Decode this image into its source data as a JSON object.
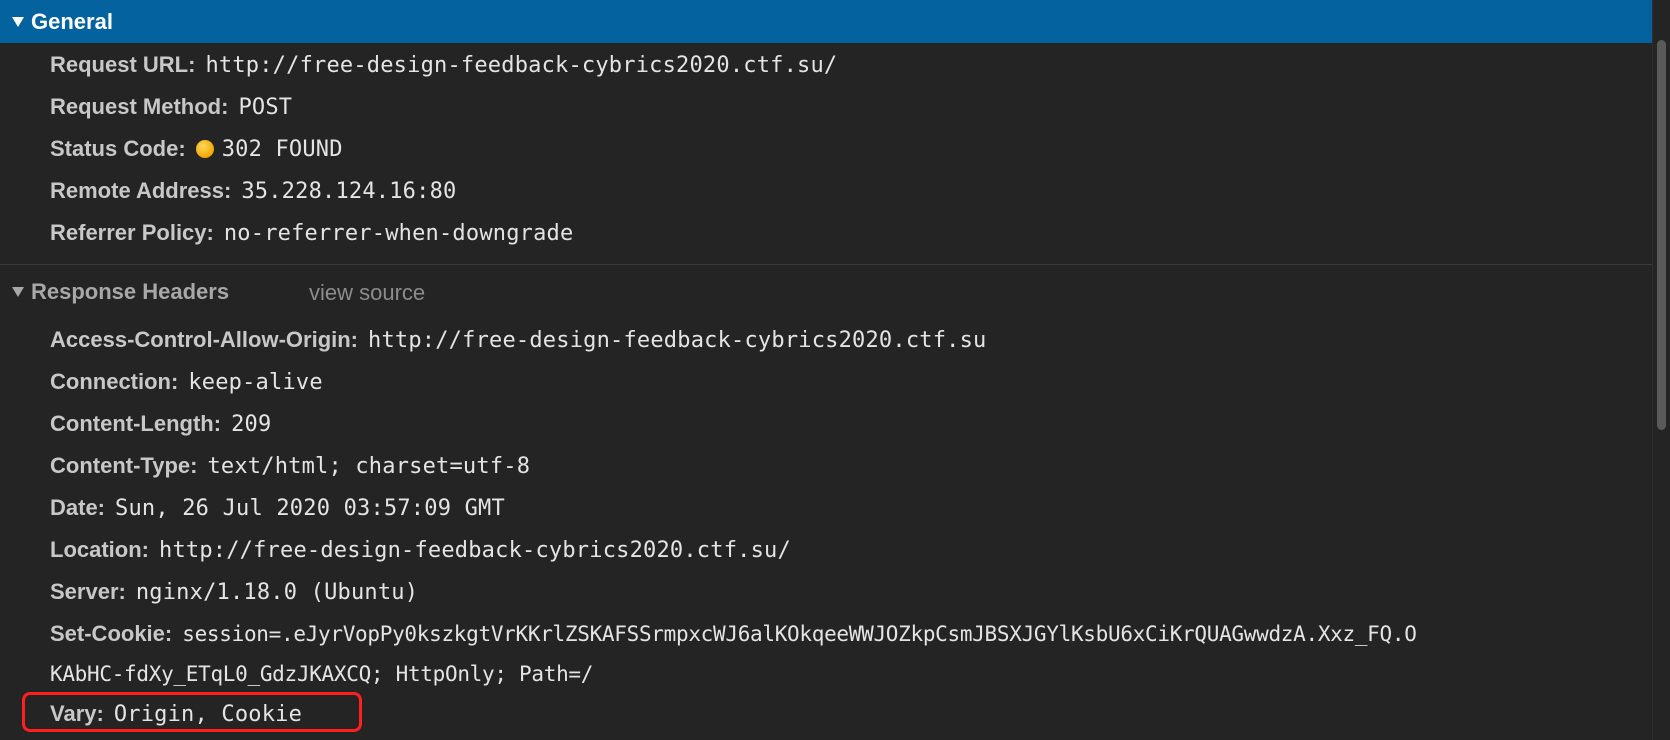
{
  "general": {
    "title": "General",
    "rows": [
      {
        "key": "Request URL:",
        "value": "http://free-design-feedback-cybrics2020.ctf.su/"
      },
      {
        "key": "Request Method:",
        "value": "POST"
      },
      {
        "key": "Status Code:",
        "value": "302 FOUND"
      },
      {
        "key": "Remote Address:",
        "value": "35.228.124.16:80"
      },
      {
        "key": "Referrer Policy:",
        "value": "no-referrer-when-downgrade"
      }
    ]
  },
  "response_headers": {
    "title": "Response Headers",
    "view_source_label": "view source",
    "rows": [
      {
        "key": "Access-Control-Allow-Origin:",
        "value": "http://free-design-feedback-cybrics2020.ctf.su"
      },
      {
        "key": "Connection:",
        "value": "keep-alive"
      },
      {
        "key": "Content-Length:",
        "value": "209"
      },
      {
        "key": "Content-Type:",
        "value": "text/html; charset=utf-8"
      },
      {
        "key": "Date:",
        "value": "Sun, 26 Jul 2020 03:57:09 GMT"
      },
      {
        "key": "Location:",
        "value": "http://free-design-feedback-cybrics2020.ctf.su/"
      },
      {
        "key": "Server:",
        "value": "nginx/1.18.0 (Ubuntu)"
      },
      {
        "key": "Set-Cookie:",
        "value": "session=.eJyrVopPy0kszkgtVrKKrlZSKAFSSrmpxcWJ6alKOkqeeWWJOZkpCsmJBSXJGYlKsbU6xCiKrQUAGwwdzA.Xxz_FQ.O",
        "continuation": "KAbHC-fdXy_ETqL0_GdzJKAXCQ; HttpOnly; Path=/"
      },
      {
        "key": "Vary:",
        "value": "Origin, Cookie"
      }
    ]
  },
  "icons": {
    "section_toggle": "triangle-down-icon",
    "status_indicator": "status-dot-icon"
  },
  "colors": {
    "header_blue": "#04639f",
    "status_dot": "#f0a800",
    "highlight": "#ff1f1f"
  }
}
